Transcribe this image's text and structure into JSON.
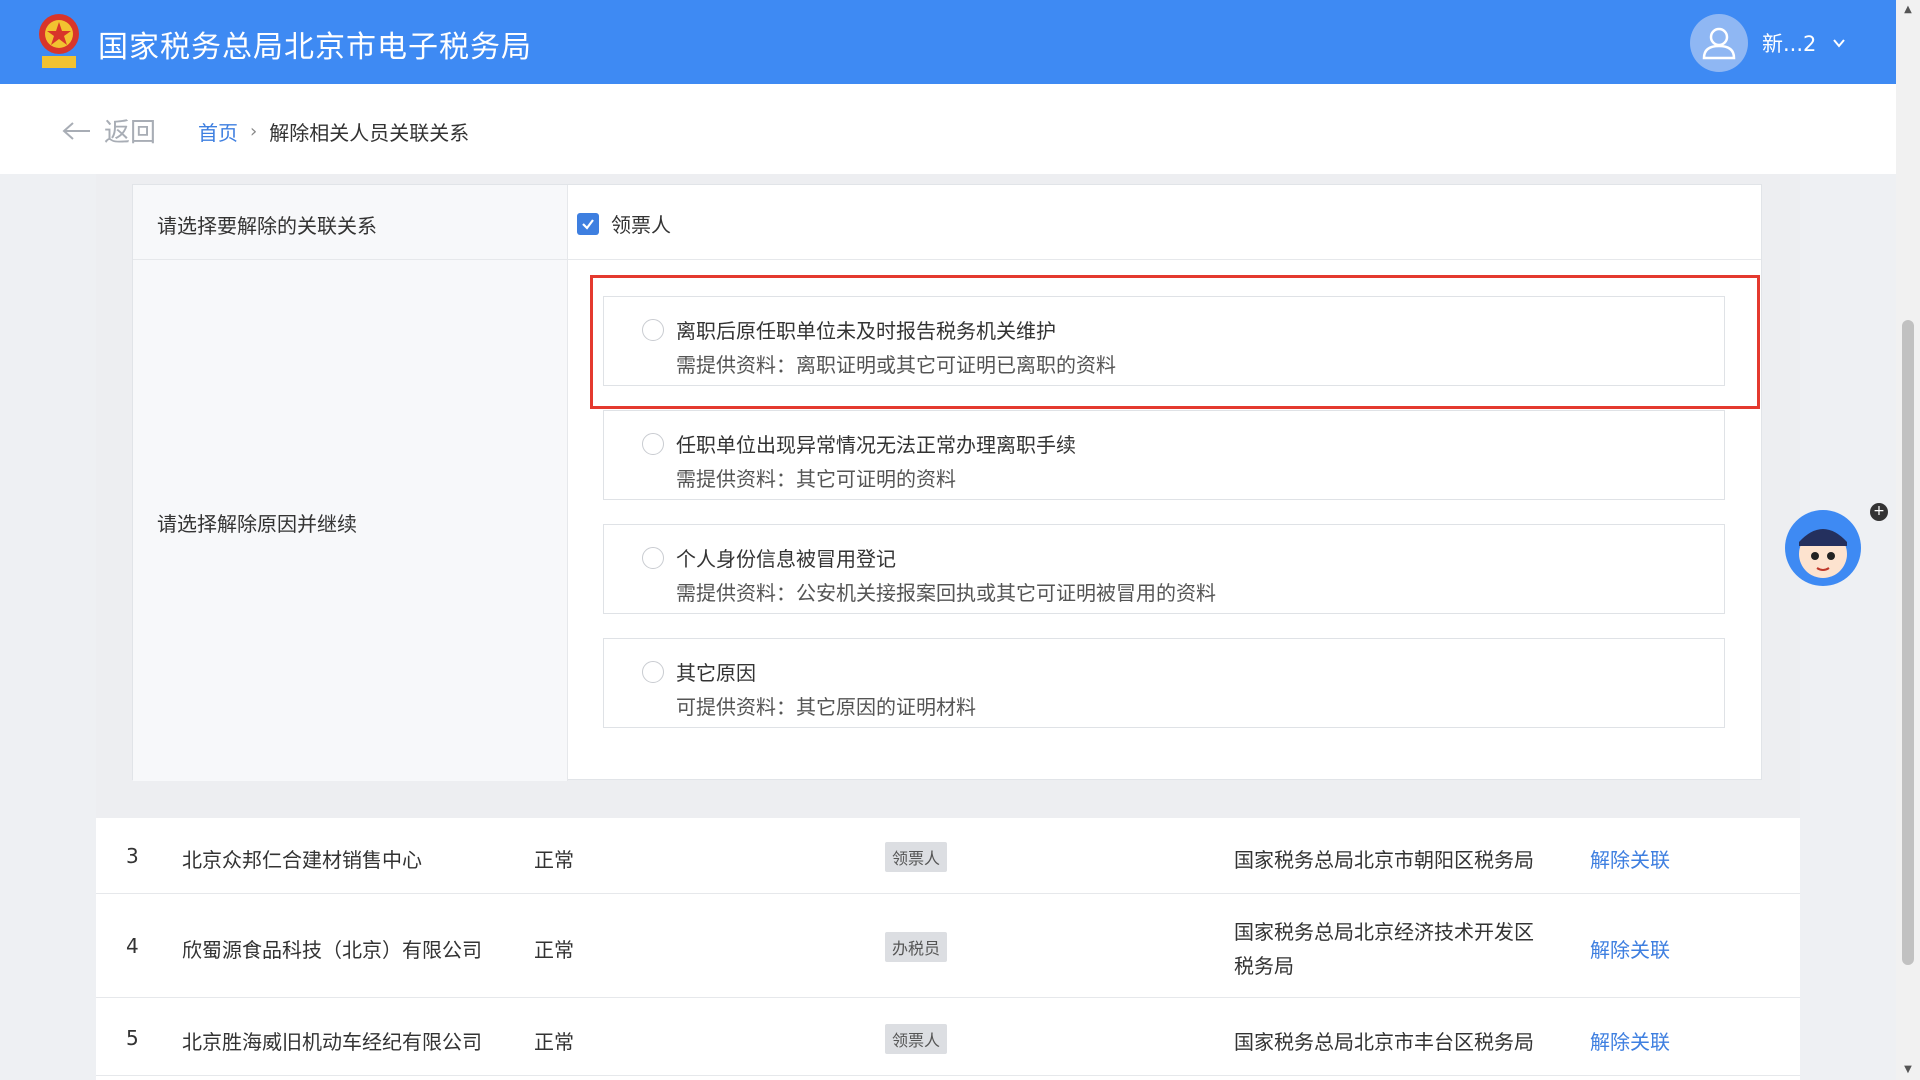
{
  "header": {
    "title": "国家税务总局北京市电子税务局",
    "user_name": "新...2"
  },
  "breadcrumb": {
    "back_label": "返回",
    "home": "首页",
    "current": "解除相关人员关联关系"
  },
  "form": {
    "relation_label": "请选择要解除的关联关系",
    "relation_option": "领票人",
    "relation_checked": true,
    "reason_label": "请选择解除原因并继续",
    "options": [
      {
        "title": "离职后原任职单位未及时报告税务机关维护",
        "desc": "需提供资料：离职证明或其它可证明已离职的资料"
      },
      {
        "title": "任职单位出现异常情况无法正常办理离职手续",
        "desc": "需提供资料：其它可证明的资料"
      },
      {
        "title": "个人身份信息被冒用登记",
        "desc": "需提供资料：公安机关接报案回执或其它可证明被冒用的资料"
      },
      {
        "title": "其它原因",
        "desc": "可提供资料：其它原因的证明材料"
      }
    ]
  },
  "table": {
    "rows": [
      {
        "index": "3",
        "company": "北京众邦仁合建材销售中心",
        "status": "正常",
        "role": "领票人",
        "authority": "国家税务总局北京市朝阳区税务局",
        "authority2": "",
        "action": "解除关联"
      },
      {
        "index": "4",
        "company": "欣蜀源食品科技（北京）有限公司",
        "status": "正常",
        "role": "办税员",
        "authority": "国家税务总局北京经济技术开发区",
        "authority2": "税务局",
        "action": "解除关联"
      },
      {
        "index": "5",
        "company": "北京胜海威旧机动车经纪有限公司",
        "status": "正常",
        "role": "领票人",
        "authority": "国家税务总局北京市丰台区税务局",
        "authority2": "",
        "action": "解除关联"
      }
    ]
  },
  "colors": {
    "header_bg": "#3e8af3",
    "link": "#3e7fe0",
    "highlight": "#e4392f"
  }
}
